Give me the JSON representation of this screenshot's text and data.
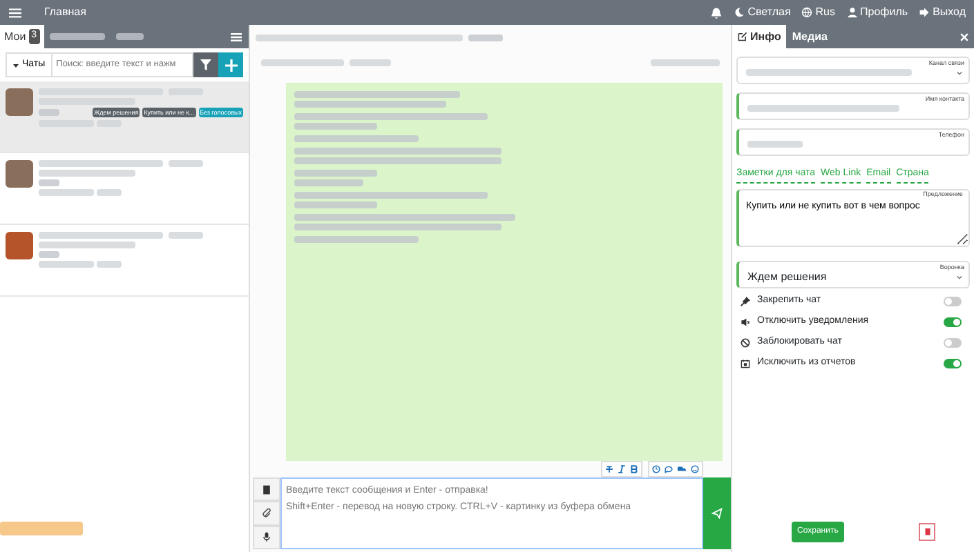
{
  "navbar": {
    "title": "Главная",
    "links": [
      {
        "label": "Светлая",
        "kind": "moon"
      },
      {
        "label": "Rus",
        "kind": "globe"
      },
      {
        "label": "Профиль",
        "kind": "user"
      },
      {
        "label": "Выход",
        "kind": "exit"
      }
    ]
  },
  "left_panel": {
    "tabs": [
      {
        "label": "Мои",
        "count": "3",
        "selected": true
      }
    ],
    "chats_dropdown": "Чаты",
    "search": {
      "placeholder": "Поиск: введите текст и нажм"
    },
    "chats": [
      {
        "selected": true,
        "tags": [
          {
            "label": "Ждем решения",
            "color": "#5a6268"
          },
          {
            "label": "Купить или не к...",
            "color": "#5a6268"
          },
          {
            "label": "Без голосовых",
            "color": "#17a2b8"
          }
        ]
      },
      {
        "selected": false
      },
      {
        "selected": false
      }
    ]
  },
  "composer": {
    "placeholder": "Введите текст сообщения и Enter - отправка!\nShift+Enter - перевод на новую строку. CTRL+V - картинку из буфера обмена"
  },
  "right_panel": {
    "tabs": [
      {
        "label": "Инфо",
        "selected": true
      },
      {
        "label": "Медиа",
        "selected": false
      }
    ],
    "fields": [
      {
        "label": "Канал связи",
        "kind": "select"
      },
      {
        "label": "Имя контакта",
        "kind": "input"
      },
      {
        "label": "Телефон",
        "kind": "input"
      }
    ],
    "links": [
      "Заметки для чата",
      "Web Link",
      "Email",
      "Страна"
    ],
    "offer": {
      "label": "Предложение",
      "value": "Купить или не купить вот в чем вопрос"
    },
    "funnel": {
      "label": "Воронка",
      "value": "Ждем решения"
    },
    "toggles": [
      {
        "label": "Закрепить чат",
        "kind": "pin",
        "on": false
      },
      {
        "label": "Отключить уведомления",
        "kind": "mute",
        "on": true
      },
      {
        "label": "Заблокировать чат",
        "kind": "block",
        "on": false
      },
      {
        "label": "Исключить из отчетов",
        "kind": "calendar",
        "on": true
      }
    ],
    "save_button": "Сохранить"
  }
}
